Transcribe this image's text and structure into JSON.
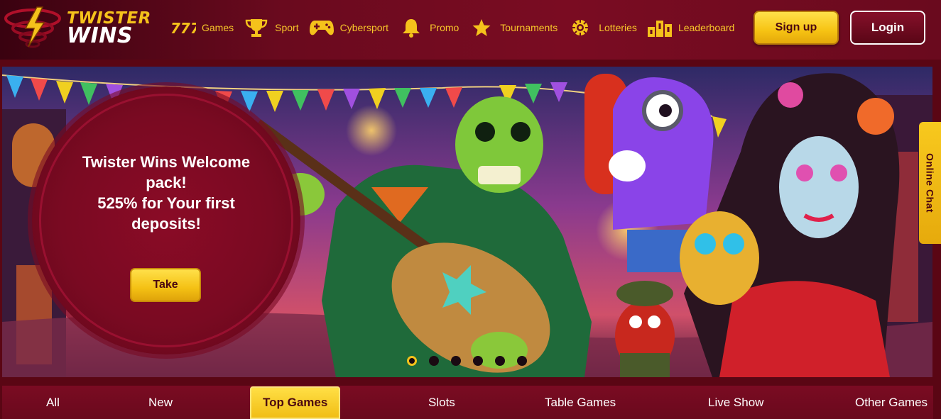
{
  "brand": {
    "line1": "TWISTER",
    "line2": "WINS"
  },
  "nav": [
    {
      "label": "Games",
      "icon": "slot-777-icon"
    },
    {
      "label": "Sport",
      "icon": "trophy-icon"
    },
    {
      "label": "Cybersport",
      "icon": "gamepad-icon"
    },
    {
      "label": "Promo",
      "icon": "bell-icon"
    },
    {
      "label": "Tournaments",
      "icon": "star-icon"
    },
    {
      "label": "Lotteries",
      "icon": "lottery-ball-icon"
    },
    {
      "label": "Leaderboard",
      "icon": "podium-icon"
    }
  ],
  "auth": {
    "signup_label": "Sign up",
    "login_label": "Login"
  },
  "banner": {
    "title_lines": [
      "Twister Wins Welcome",
      "pack!",
      "525% for Your first",
      "deposits!"
    ],
    "cta_label": "Take",
    "slides": 6,
    "active_slide": 1
  },
  "chat": {
    "label": "Online Chat"
  },
  "tabs": [
    {
      "label": "All"
    },
    {
      "label": "New"
    },
    {
      "label": "Top Games",
      "active": true
    },
    {
      "label": "Slots"
    },
    {
      "label": "Table Games"
    },
    {
      "label": "Live Show"
    },
    {
      "label": "Other Games"
    }
  ],
  "colors": {
    "accent": "#f5c21b",
    "brand_dark": "#6a0a1e",
    "text_on_accent": "#4a0610"
  }
}
